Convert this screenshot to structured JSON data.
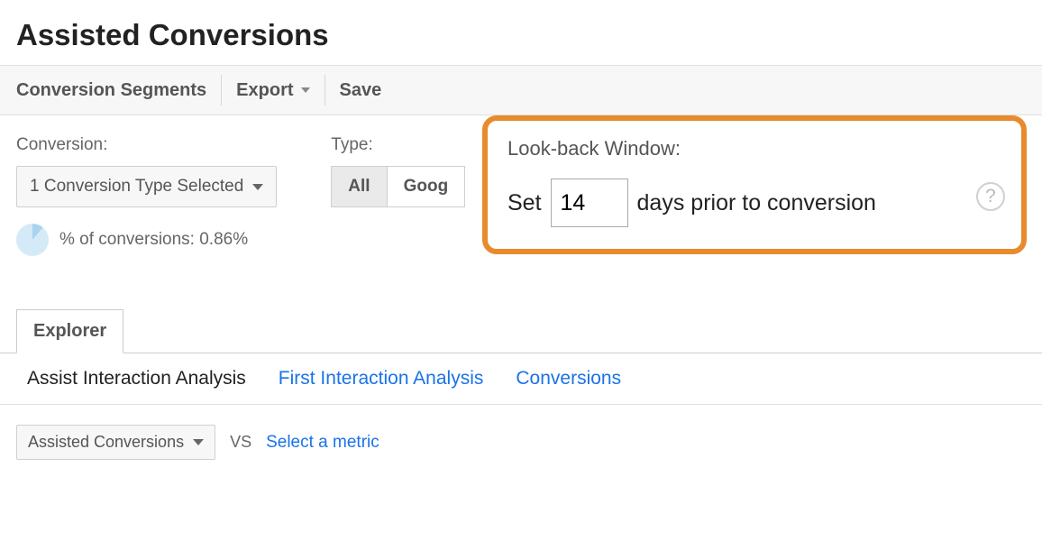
{
  "page": {
    "title": "Assisted Conversions"
  },
  "toolbar": {
    "segments_label": "Conversion Segments",
    "export_label": "Export",
    "save_label": "Save"
  },
  "filters": {
    "conversion": {
      "label": "Conversion:",
      "selected_text": "1 Conversion Type Selected",
      "pct_label": "% of conversions: 0.86%"
    },
    "type": {
      "label": "Type:",
      "all": "All",
      "google_truncated": "Goog"
    },
    "lookback": {
      "title": "Look-back Window:",
      "set_text": "Set",
      "days_value": "14",
      "suffix_text": "days prior to conversion"
    }
  },
  "tabs": {
    "explorer": "Explorer"
  },
  "subtabs": {
    "assist": "Assist Interaction Analysis",
    "first": "First Interaction Analysis",
    "conversions": "Conversions"
  },
  "metrics": {
    "primary_select": "Assisted Conversions",
    "vs": "vs",
    "select_metric": "Select a metric"
  }
}
